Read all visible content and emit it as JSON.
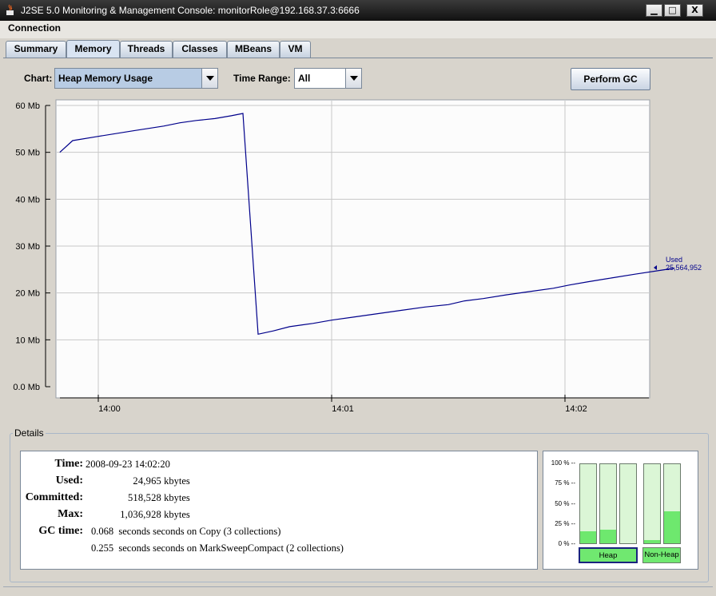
{
  "window": {
    "title": "J2SE 5.0 Monitoring & Management Console: monitorRole@192.168.37.3:6666",
    "minimize_label": "▁",
    "maximize_label": "□",
    "close_label": "X"
  },
  "menu": {
    "items": [
      "Connection"
    ]
  },
  "tabs": [
    {
      "label": "Summary",
      "active": false
    },
    {
      "label": "Memory",
      "active": true
    },
    {
      "label": "Threads",
      "active": false
    },
    {
      "label": "Classes",
      "active": false
    },
    {
      "label": "MBeans",
      "active": false
    },
    {
      "label": "VM",
      "active": false
    }
  ],
  "controls": {
    "chart_label": "Chart:",
    "chart_value": "Heap Memory Usage",
    "time_range_label": "Time Range:",
    "time_range_value": "All",
    "perform_gc_label": "Perform GC"
  },
  "colors": {
    "series_line": "#00008b",
    "bar_fill": "#6ee86e",
    "bar_background": "#dbf6d6",
    "selected_pool_border": "#1a237e"
  },
  "chart_data": {
    "type": "line",
    "x_unit": "minutes after 14:00",
    "ylim": [
      0,
      60
    ],
    "y_ticks": [
      "0.0 Mb",
      "10 Mb",
      "20 Mb",
      "30 Mb",
      "40 Mb",
      "50 Mb",
      "60 Mb"
    ],
    "x_ticks": [
      {
        "label": "14:00",
        "x": 0
      },
      {
        "label": "14:01",
        "x": 1
      },
      {
        "label": "14:02",
        "x": 2
      }
    ],
    "grid": true,
    "series": [
      {
        "name": "Used",
        "points": [
          [
            -0.165,
            50.0
          ],
          [
            -0.11,
            52.5
          ],
          [
            0.0,
            53.4
          ],
          [
            0.15,
            54.6
          ],
          [
            0.28,
            55.6
          ],
          [
            0.35,
            56.3
          ],
          [
            0.42,
            56.8
          ],
          [
            0.5,
            57.2
          ],
          [
            0.57,
            57.8
          ],
          [
            0.62,
            58.3
          ],
          [
            0.685,
            11.2
          ],
          [
            0.75,
            11.9
          ],
          [
            0.82,
            12.8
          ],
          [
            0.92,
            13.5
          ],
          [
            1.0,
            14.2
          ],
          [
            1.1,
            14.9
          ],
          [
            1.2,
            15.6
          ],
          [
            1.3,
            16.3
          ],
          [
            1.4,
            17.0
          ],
          [
            1.5,
            17.5
          ],
          [
            1.57,
            18.3
          ],
          [
            1.65,
            18.8
          ],
          [
            1.75,
            19.6
          ],
          [
            1.85,
            20.3
          ],
          [
            1.95,
            21.0
          ],
          [
            2.02,
            21.7
          ],
          [
            2.1,
            22.4
          ],
          [
            2.2,
            23.2
          ],
          [
            2.3,
            24.0
          ],
          [
            2.42,
            24.9
          ],
          [
            2.47,
            25.3
          ]
        ]
      }
    ],
    "annotation": {
      "series": "Used",
      "label": "Used",
      "value": "25,564,952"
    }
  },
  "details": {
    "title": "Details",
    "rows": [
      {
        "key": "Time:",
        "value": "2008-09-23 14:02:20"
      },
      {
        "key": "Used:",
        "num": "24,965",
        "unit": "kbytes"
      },
      {
        "key": "Committed:",
        "num": "518,528",
        "unit": "kbytes"
      },
      {
        "key": "Max:",
        "num": "1,036,928",
        "unit": "kbytes"
      },
      {
        "key": "GC time:",
        "num": "0.068",
        "unit": "seconds seconds on Copy (3 collections)"
      },
      {
        "key": "",
        "num": "0.255",
        "unit": "seconds seconds on MarkSweepCompact (2 collections)"
      }
    ]
  },
  "pool_bars": {
    "pct_labels": [
      "100 % --",
      "75 % --",
      "50 % --",
      "25 % --",
      "0 % --"
    ],
    "heap_label": "Heap",
    "non_heap_label": "Non-Heap",
    "heap_fractions": [
      0.15,
      0.17,
      0.0
    ],
    "non_heap_fractions": [
      0.04,
      0.4
    ]
  }
}
